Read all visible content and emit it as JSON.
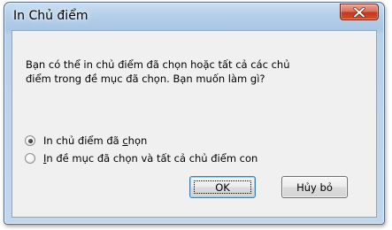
{
  "window": {
    "title": "In Chủ điểm",
    "close_icon": "close-x-icon"
  },
  "dialog": {
    "message_line1": "Bạn có thể in chủ điểm đã chọn hoặc tất cả các chủ",
    "message_line2": "điểm trong đề mục đã chọn. Bạn muốn làm gì?"
  },
  "options": [
    {
      "label_before": "In chủ điểm đã ",
      "label_accel": "c",
      "label_after": "họn",
      "checked": true
    },
    {
      "label_before": "",
      "label_accel": "I",
      "label_after": "n đề mục đã chọn và tất cả chủ điểm con",
      "checked": false
    }
  ],
  "buttons": {
    "ok_label": "OK",
    "cancel_label": "Hủy bỏ"
  },
  "colors": {
    "title_bar": "#b6d0ea",
    "close_button": "#c2391c",
    "dialog_background": "#f0f0f0",
    "default_button_border": "#3c7fb1"
  }
}
